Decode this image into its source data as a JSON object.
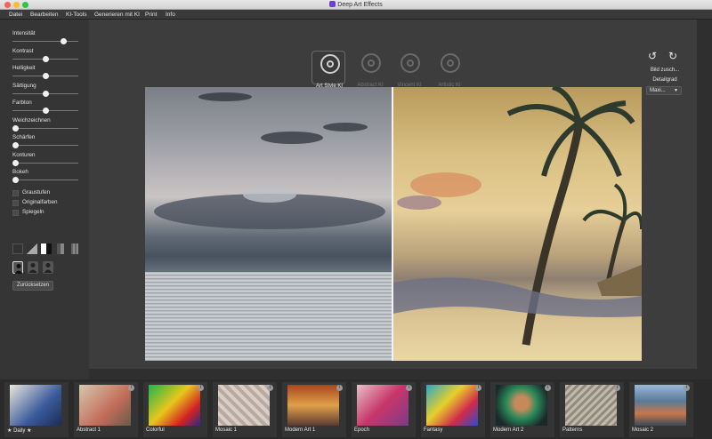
{
  "window": {
    "title": "Deep Art Effects"
  },
  "menu": [
    {
      "label": "Datei"
    },
    {
      "label": "Bearbeiten"
    },
    {
      "label": "KI-Tools"
    },
    {
      "label": "Generieren mit KI"
    },
    {
      "label": "Print"
    },
    {
      "label": "Info"
    }
  ],
  "adjustments": {
    "sliders": [
      {
        "label": "Intensität",
        "value": 0.8
      },
      {
        "label": "Kontrast",
        "value": 0.5
      },
      {
        "label": "Helligkeit",
        "value": 0.5
      },
      {
        "label": "Sättigung",
        "value": 0.5
      },
      {
        "label": "Farbton",
        "value": 0.5
      },
      {
        "label": "Weichzeichnen",
        "value": 0.0
      },
      {
        "label": "Schärfen",
        "value": 0.0
      },
      {
        "label": "Konturen",
        "value": 0.0
      },
      {
        "label": "Bokeh",
        "value": 0.0
      }
    ],
    "checkboxes": [
      {
        "label": "Graustufen",
        "checked": false
      },
      {
        "label": "Originalfarben",
        "checked": false
      },
      {
        "label": "Spiegeln",
        "checked": false
      }
    ],
    "reset_label": "Zurücksetzen"
  },
  "style_modes": [
    {
      "label": "Art Style KI",
      "active": true
    },
    {
      "label": "Abstract KI",
      "active": false
    },
    {
      "label": "Vincent KI",
      "active": false
    },
    {
      "label": "Artistic KI",
      "active": false
    }
  ],
  "tools": {
    "undo_icon": "undo-icon",
    "redo_icon": "redo-icon",
    "save_label": "Bild zusch...",
    "detail_label": "Detailgrad",
    "detail_value": "Maxi..."
  },
  "compare": {
    "split": 0.5
  },
  "styles": [
    {
      "label": "Daily",
      "prefix": "★",
      "suffix": "★"
    },
    {
      "label": "Abstract 1"
    },
    {
      "label": "Colorful"
    },
    {
      "label": "Mosaic 1"
    },
    {
      "label": "Modern Art 1"
    },
    {
      "label": "Epoch"
    },
    {
      "label": "Fantasy"
    },
    {
      "label": "Modern Art 2"
    },
    {
      "label": "Patterns"
    },
    {
      "label": "Mosaic 2"
    }
  ],
  "colors": {
    "accent_window": "#6a3fd8",
    "background": "#2f2f2f"
  }
}
